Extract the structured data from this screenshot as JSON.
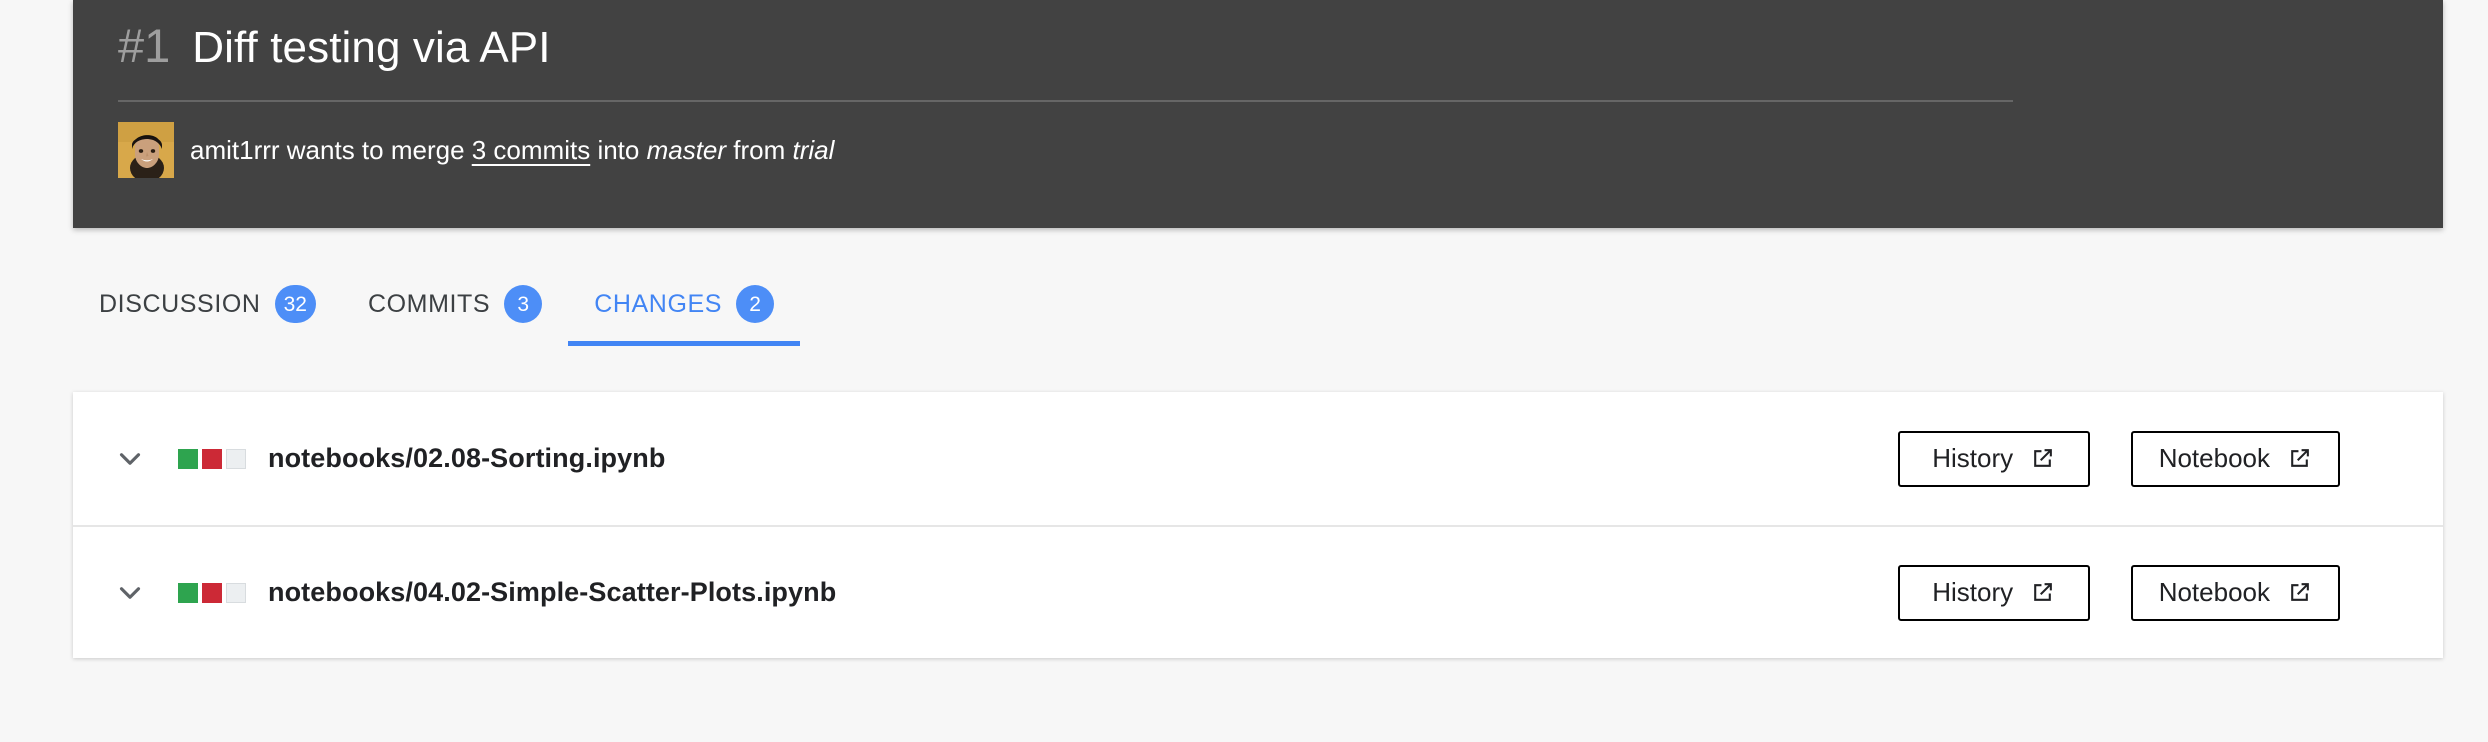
{
  "header": {
    "pr_number": "#1",
    "title": "Diff testing via API",
    "author": "amit1rrr",
    "subtitle_prefix": "amit1rrr wants to merge ",
    "commits_link": "3 commits",
    "subtitle_mid": " into ",
    "target_branch": "master",
    "subtitle_from": " from ",
    "source_branch": "trial",
    "avatar_alt": "amit1rrr avatar",
    "bg_color": "#424242"
  },
  "tabs": [
    {
      "label": "DISCUSSION",
      "badge": "32",
      "active": false
    },
    {
      "label": "COMMITS",
      "badge": "3",
      "active": false
    },
    {
      "label": "CHANGES",
      "badge": "2",
      "active": true
    }
  ],
  "colors": {
    "accent": "#4285f4",
    "badge": "#4d8ef7",
    "added": "#2ea44f",
    "deleted": "#cc2936",
    "unchanged": "#eceff1"
  },
  "files": [
    {
      "name": "notebooks/02.08-Sorting.ipynb",
      "diffstat": [
        "add",
        "del",
        "neutral"
      ],
      "history_label": "History",
      "notebook_label": "Notebook"
    },
    {
      "name": "notebooks/04.02-Simple-Scatter-Plots.ipynb",
      "diffstat": [
        "add",
        "del",
        "neutral"
      ],
      "history_label": "History",
      "notebook_label": "Notebook"
    }
  ]
}
